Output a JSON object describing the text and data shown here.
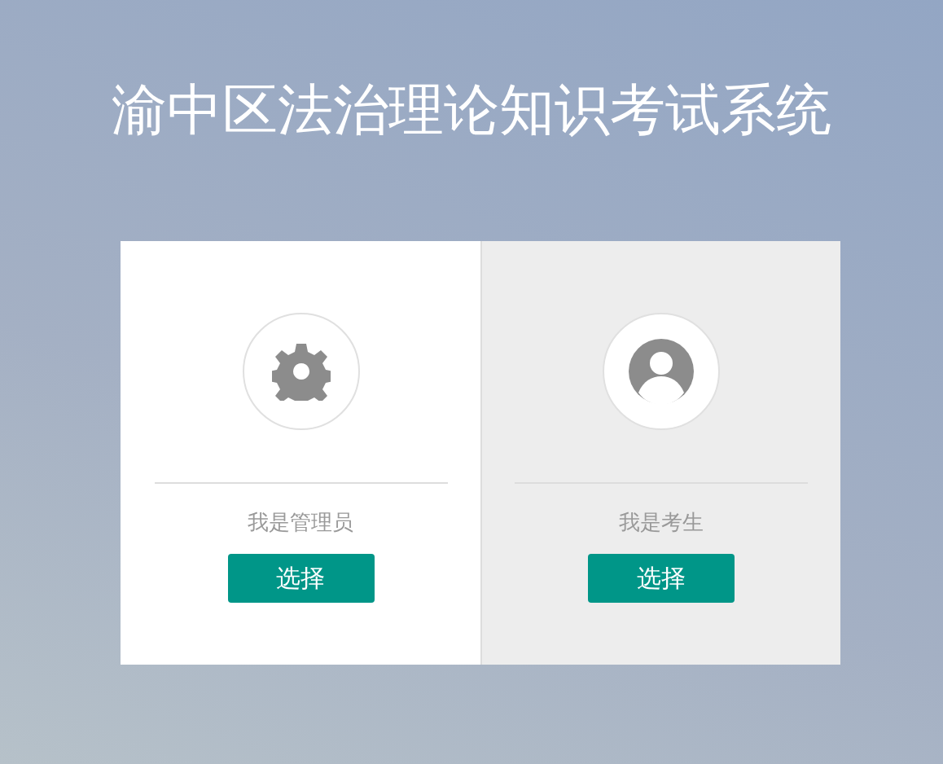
{
  "title": "渝中区法治理论知识考试系统",
  "roles": [
    {
      "kind": "admin",
      "label": "我是管理员",
      "button": "选择",
      "selected": false
    },
    {
      "kind": "student",
      "label": "我是考生",
      "button": "选择",
      "selected": true
    }
  ]
}
